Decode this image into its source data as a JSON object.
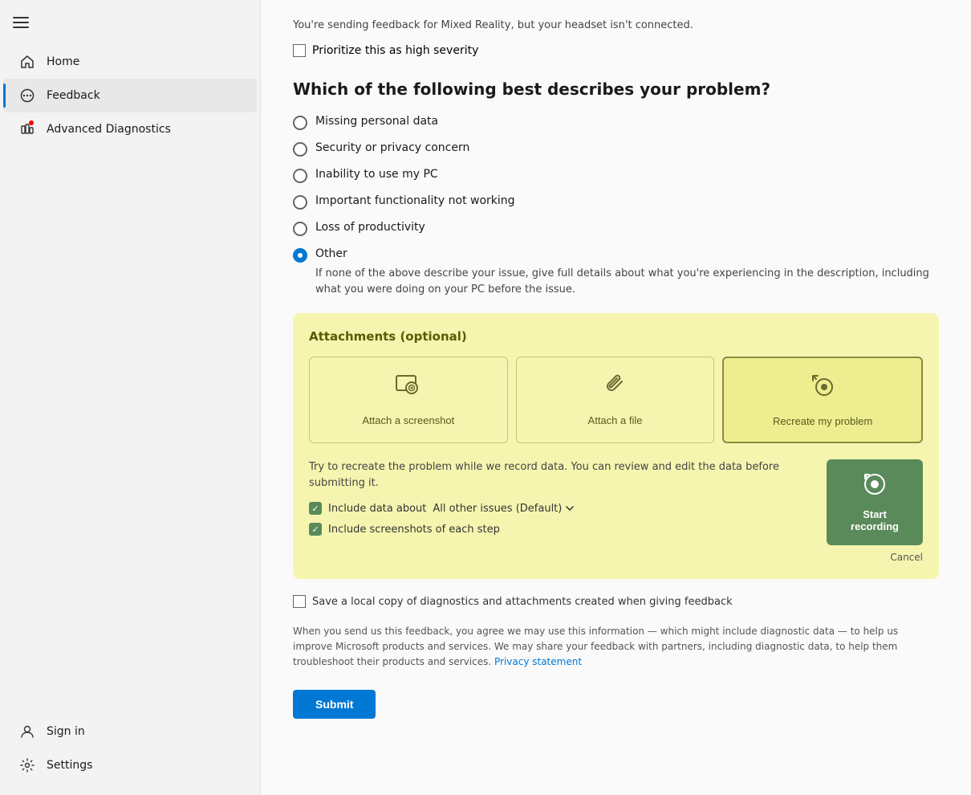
{
  "sidebar": {
    "hamburger_label": "Menu",
    "items": [
      {
        "id": "home",
        "label": "Home",
        "icon": "home",
        "active": false
      },
      {
        "id": "feedback",
        "label": "Feedback",
        "icon": "feedback",
        "active": true
      },
      {
        "id": "advanced-diagnostics",
        "label": "Advanced Diagnostics",
        "icon": "diagnostics",
        "active": false
      }
    ],
    "bottom_items": [
      {
        "id": "sign-in",
        "label": "Sign in",
        "icon": "account"
      },
      {
        "id": "settings",
        "label": "Settings",
        "icon": "settings"
      }
    ]
  },
  "main": {
    "info_text": "You're sending feedback for Mixed Reality, but your headset isn't connected.",
    "priority_label": "Prioritize this as high severity",
    "section_title": "Which of the following best describes your problem?",
    "radio_options": [
      {
        "id": "missing-personal-data",
        "label": "Missing personal data",
        "selected": false
      },
      {
        "id": "security-privacy",
        "label": "Security or privacy concern",
        "selected": false
      },
      {
        "id": "inability-to-use",
        "label": "Inability to use my PC",
        "selected": false
      },
      {
        "id": "important-functionality",
        "label": "Important functionality not working",
        "selected": false
      },
      {
        "id": "loss-of-productivity",
        "label": "Loss of productivity",
        "selected": false
      },
      {
        "id": "other",
        "label": "Other",
        "selected": true
      }
    ],
    "other_sublabel": "If none of the above describe your issue, give full details about what you're experiencing in the description, including what you were doing on your PC before the issue.",
    "attachments": {
      "title": "Attachments (optional)",
      "attach_screenshot_label": "Attach a screenshot",
      "attach_file_label": "Attach a file",
      "recreate_label": "Recreate my problem",
      "recreate_desc": "Try to recreate the problem while we record data. You can review and edit the data before submitting it.",
      "include_data_label": "Include data about",
      "include_data_value": "All other issues (Default)",
      "include_screenshots_label": "Include screenshots of each step",
      "start_recording_label": "Start recording",
      "cancel_label": "Cancel"
    },
    "save_local_label": "Save a local copy of diagnostics and attachments created when giving feedback",
    "legal_text": "When you send us this feedback, you agree we may use this information — which might include diagnostic data — to help us improve Microsoft products and services. We may share your feedback with partners, including diagnostic data, to help them troubleshoot their products and services.",
    "privacy_link": "Privacy statement",
    "submit_label": "Submit"
  }
}
